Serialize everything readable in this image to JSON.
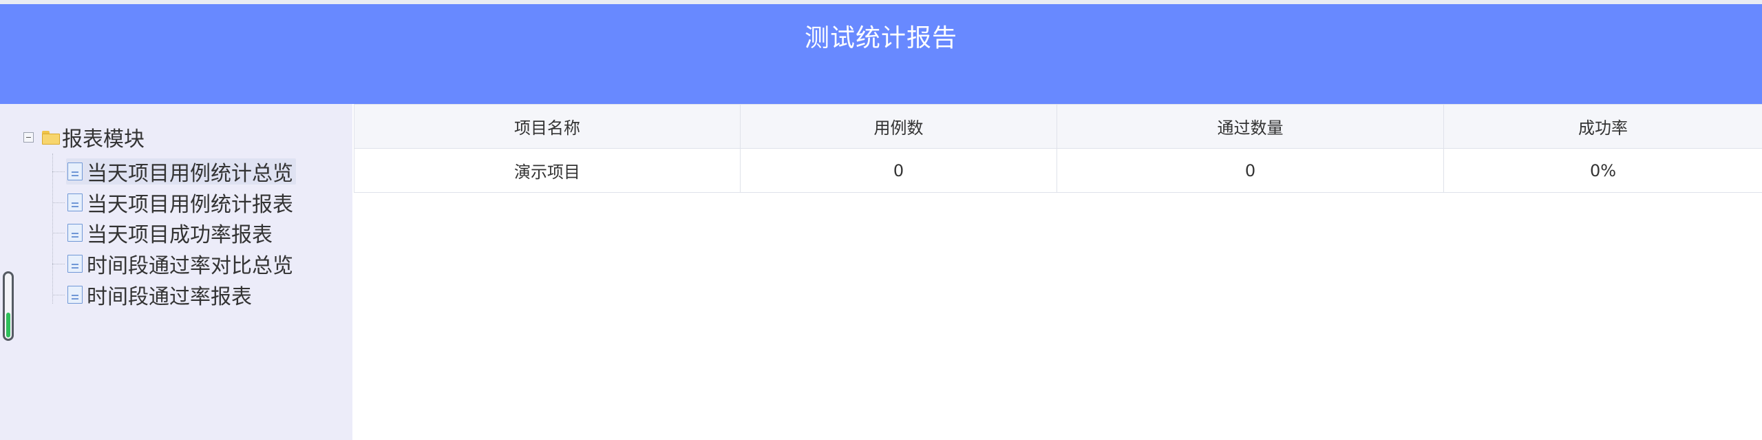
{
  "header": {
    "title": "测试统计报告",
    "color": "#6889ff"
  },
  "sidebar": {
    "root": {
      "label": "报表模块",
      "icon": "folder-open-icon",
      "toggle_icon": "collapse-minus-icon"
    },
    "items": [
      {
        "label": "当天项目用例统计总览",
        "icon": "document-icon",
        "selected": true
      },
      {
        "label": "当天项目用例统计报表",
        "icon": "document-icon",
        "selected": false
      },
      {
        "label": "当天项目成功率报表",
        "icon": "document-icon",
        "selected": false
      },
      {
        "label": "时间段通过率对比总览",
        "icon": "document-icon",
        "selected": false
      },
      {
        "label": "时间段通过率报表",
        "icon": "document-icon",
        "selected": false
      }
    ],
    "selected_color": "#dfe2f2",
    "background": "#ececf9"
  },
  "table": {
    "columns": [
      "项目名称",
      "用例数",
      "通过数量",
      "成功率"
    ],
    "rows": [
      [
        "演示项目",
        "0",
        "0",
        "0%"
      ]
    ]
  }
}
